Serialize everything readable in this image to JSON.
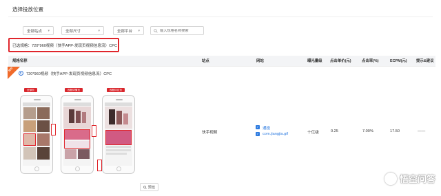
{
  "page": {
    "title": "选择投放位置"
  },
  "filters": {
    "site": {
      "value": "全部站点"
    },
    "size": {
      "value": "全部尺寸"
    },
    "platform": {
      "value": "全部平台"
    },
    "search": {
      "placeholder": "输入规格名称搜索"
    }
  },
  "selected": {
    "text": "已选规格：720*960视频（快手APP-发现页视频信息流）CPC"
  },
  "table": {
    "headers": [
      "规格名称",
      "站点",
      "网站",
      "曝光量级",
      "点击单价(元)",
      "点击率(%)",
      "ECPM(元)",
      "提示&建议"
    ],
    "row": {
      "badge": "推荐",
      "name": "720*960视频（快手APP-发现页视频信息流）CPC",
      "phone_tags": [
        "全部页",
        "视频详情页",
        "视频评论页"
      ],
      "site": "快手视频",
      "websites": [
        "通投",
        "com.jiangjia.gif"
      ],
      "exposure": "十亿级",
      "cpc": "0.25",
      "ctr": "7.00%",
      "ecpm": "17.50",
      "tips": "——",
      "preview_label": "预览"
    }
  },
  "watermark": {
    "text": "悟空问答"
  },
  "colors": {
    "highlight": "#e0262c",
    "badge": "#f06a2a",
    "link": "#2d7be0"
  }
}
